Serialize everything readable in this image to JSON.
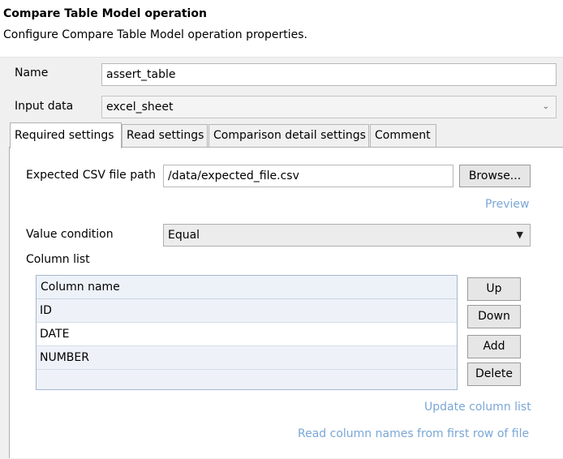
{
  "header": {
    "title": "Compare Table Model operation",
    "subtitle": "Configure Compare Table Model operation properties."
  },
  "form": {
    "name_label": "Name",
    "name_value": "assert_table",
    "input_data_label": "Input data",
    "input_data_value": "excel_sheet"
  },
  "tabs": [
    {
      "label": "Required settings",
      "active": true
    },
    {
      "label": "Read settings",
      "active": false
    },
    {
      "label": "Comparison detail settings",
      "active": false
    },
    {
      "label": "Comment",
      "active": false
    }
  ],
  "required": {
    "csv_label": "Expected CSV file path",
    "csv_value": "/data/expected_file.csv",
    "browse_label": "Browse...",
    "preview_label": "Preview",
    "value_condition_label": "Value condition",
    "value_condition_value": "Equal",
    "column_list_label": "Column list",
    "column_header": "Column name",
    "columns": [
      "ID",
      "DATE",
      "NUMBER"
    ],
    "buttons": {
      "up": "Up",
      "down": "Down",
      "add": "Add",
      "delete": "Delete"
    },
    "update_link": "Update column list",
    "read_names_link": "Read column names from first row of file"
  },
  "icons": {
    "combo_arrow": "chevron-down-icon",
    "dropdown_arrow": "caret-down-icon"
  },
  "colors": {
    "link": "#7aa7d6",
    "table_border": "#a5b7cc"
  }
}
